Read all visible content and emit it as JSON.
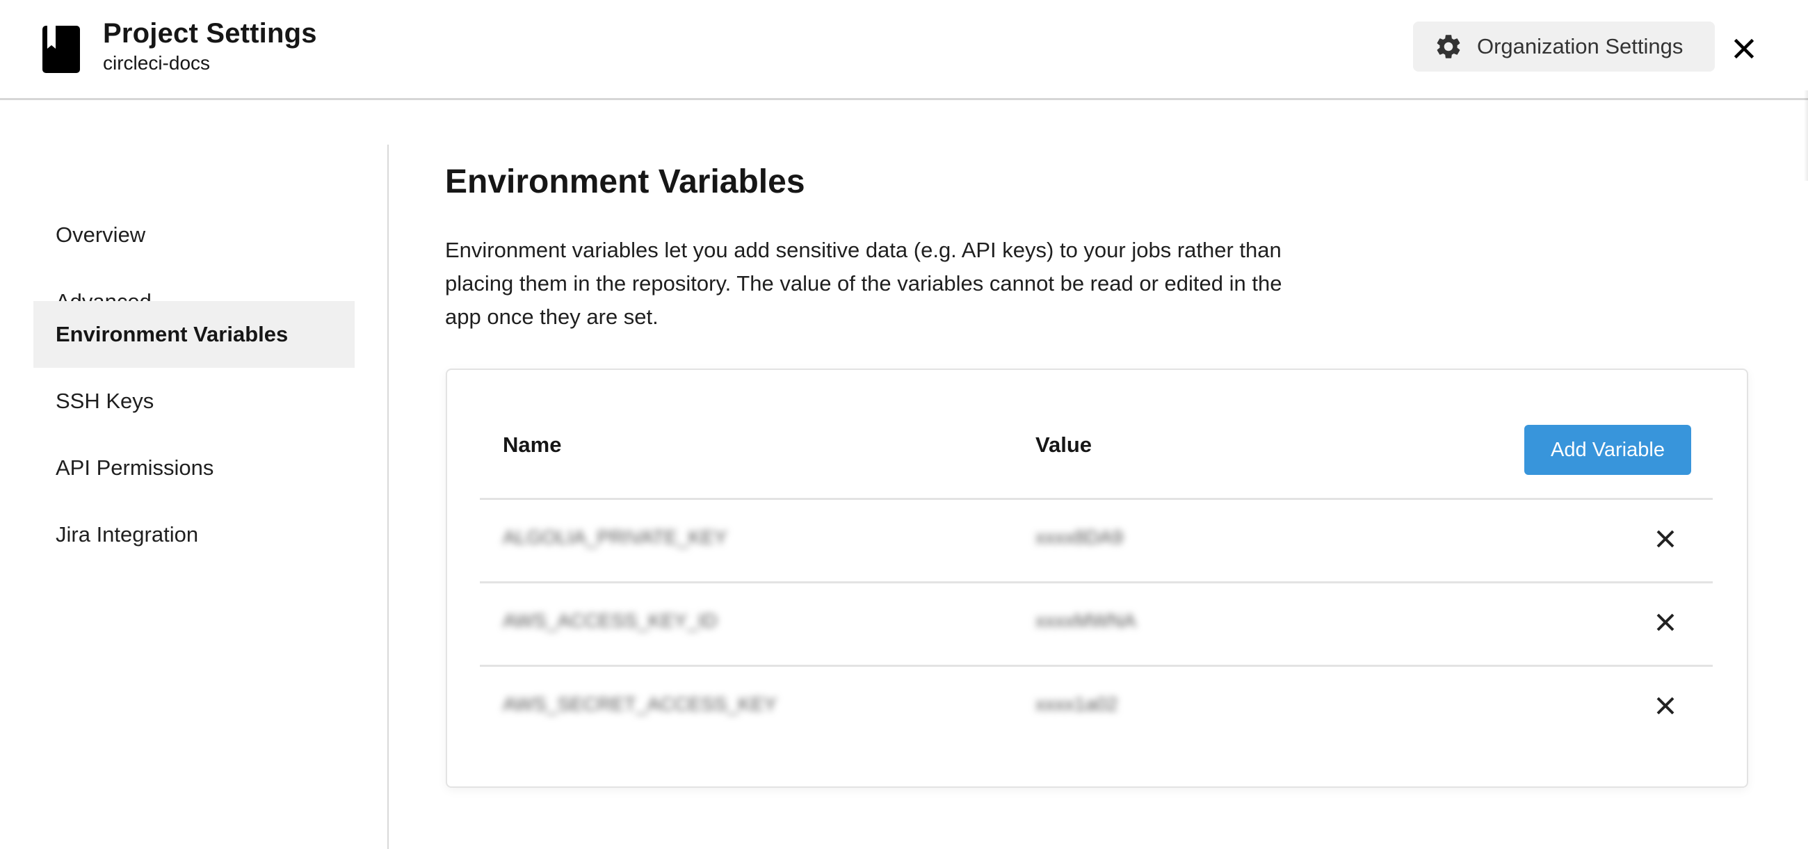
{
  "header": {
    "title": "Project Settings",
    "subtitle": "circleci-docs",
    "project_icon": "bookmark-book-icon",
    "org_settings_button": {
      "label": "Organization Settings",
      "icon": "gear-icon"
    },
    "close_icon": "close-icon"
  },
  "sidebar": {
    "items": [
      {
        "label": "Overview",
        "active": false
      },
      {
        "label": "Advanced",
        "active": false
      },
      {
        "label": "Environment Variables",
        "active": true
      },
      {
        "label": "SSH Keys",
        "active": false
      },
      {
        "label": "API Permissions",
        "active": false
      },
      {
        "label": "Jira Integration",
        "active": false
      }
    ]
  },
  "main": {
    "title": "Environment Variables",
    "description": "Environment variables let you add sensitive data (e.g. API keys) to your jobs rather than placing them in the repository. The value of the variables cannot be read or edited in the app once they are set.",
    "table": {
      "columns": [
        "Name",
        "Value"
      ],
      "add_button_label": "Add Variable",
      "rows": [
        {
          "name": "ALGOLIA_PRIVATE_KEY",
          "value": "xxxx8DA9",
          "blurred": true
        },
        {
          "name": "AWS_ACCESS_KEY_ID",
          "value": "xxxxMWNA",
          "blurred": true
        },
        {
          "name": "AWS_SECRET_ACCESS_KEY",
          "value": "xxxx1a02",
          "blurred": true
        }
      ],
      "delete_icon": "close-icon"
    }
  },
  "colors": {
    "accent": "#3895db",
    "active_nav_bg": "#f0f0f0",
    "divider": "#e3e3e3",
    "text": "#161616"
  }
}
